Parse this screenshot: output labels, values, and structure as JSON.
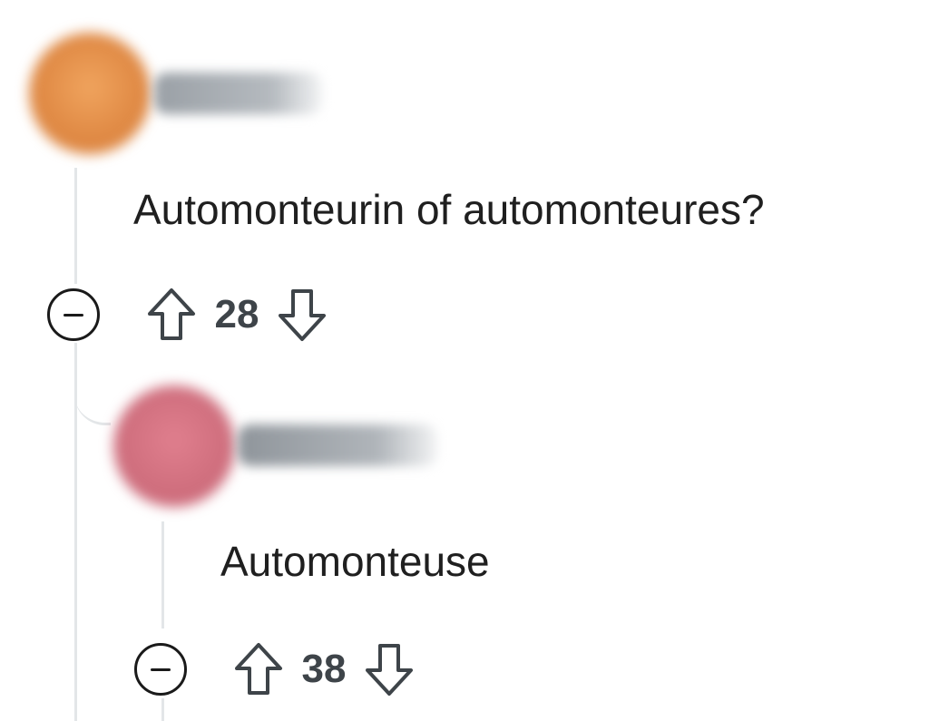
{
  "comments": [
    {
      "body": "Automonteurin of automonteures?",
      "score": "28",
      "avatar_color": "#e8964f"
    },
    {
      "body": "Automonteuse",
      "score": "38",
      "avatar_color": "#d97684"
    }
  ],
  "icons": {
    "collapse": "minus-circle-icon",
    "upvote": "arrow-up-outline-icon",
    "downvote": "arrow-down-outline-icon"
  },
  "colors": {
    "thread_line": "#e3e6e8",
    "score_text": "#3e4449"
  }
}
